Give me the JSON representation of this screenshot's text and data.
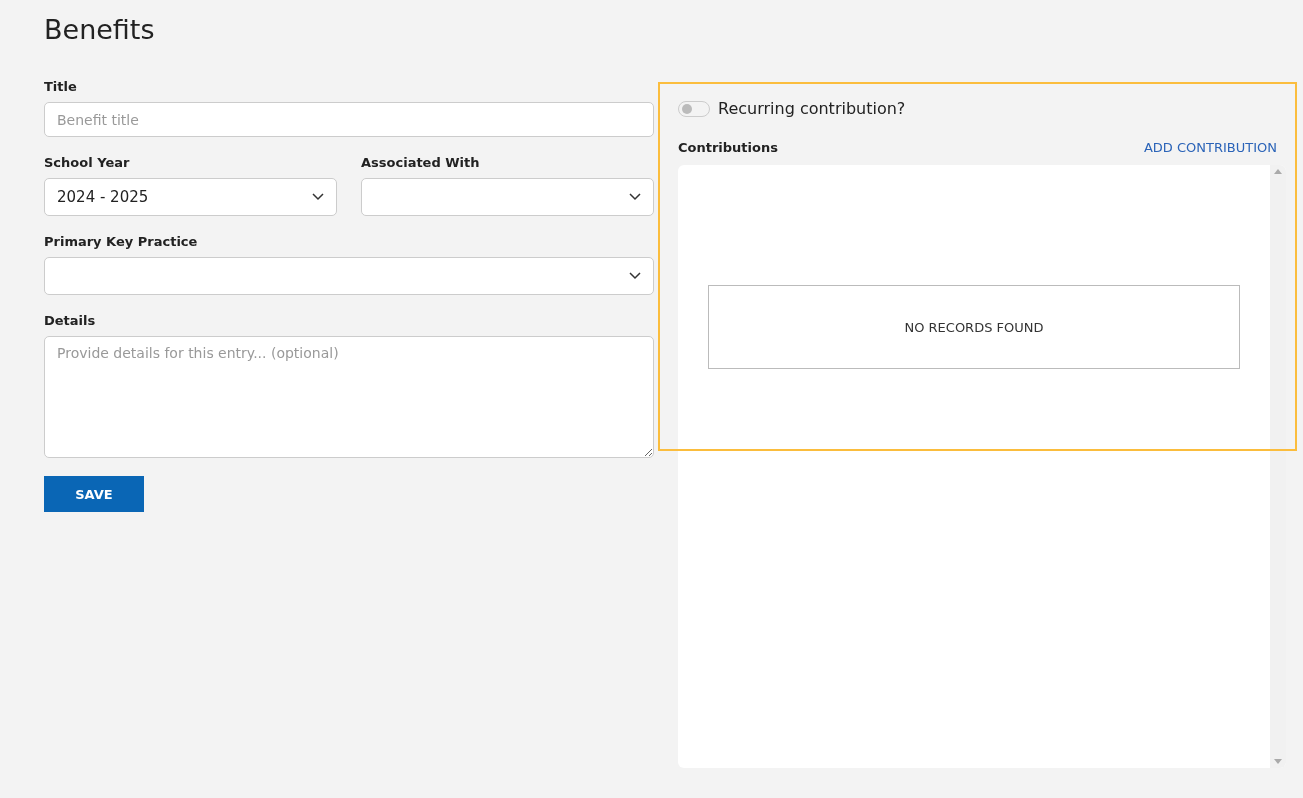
{
  "page": {
    "title": "Benefits"
  },
  "form": {
    "title_field": {
      "label": "Title",
      "placeholder": "Benefit title"
    },
    "school_year": {
      "label": "School Year",
      "value": "2024 - 2025"
    },
    "associated_with": {
      "label": "Associated With"
    },
    "primary_key_practice": {
      "label": "Primary Key Practice"
    },
    "details": {
      "label": "Details",
      "placeholder": "Provide details for this entry... (optional)"
    },
    "save_button": "SAVE"
  },
  "contributions": {
    "recurring": {
      "label": "Recurring contribution?",
      "on": false
    },
    "heading": "Contributions",
    "add_link": "ADD CONTRIBUTION",
    "empty_message": "NO RECORDS FOUND"
  }
}
